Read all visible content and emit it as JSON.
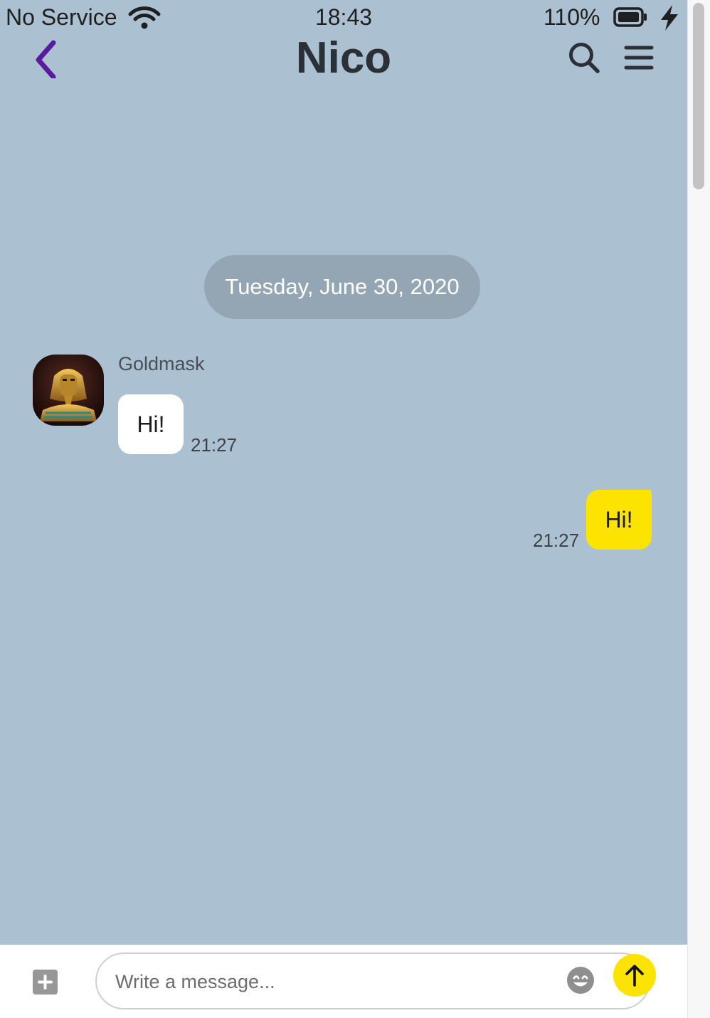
{
  "status_bar": {
    "carrier": "No Service",
    "time": "18:43",
    "battery_percent": "110%",
    "wifi_icon": "wifi-icon",
    "battery_icon": "battery-icon",
    "charging_icon": "lightning-bolt-icon"
  },
  "header": {
    "title": "Nico",
    "back_icon": "chevron-left-icon",
    "search_icon": "search-icon",
    "menu_icon": "hamburger-menu-icon"
  },
  "chat": {
    "date_divider": "Tuesday, June 30, 2020",
    "messages": [
      {
        "direction": "incoming",
        "sender": "Goldmask",
        "text": "Hi!",
        "time": "21:27"
      },
      {
        "direction": "outgoing",
        "text": "Hi!",
        "time": "21:27"
      }
    ]
  },
  "composer": {
    "placeholder": "Write a message...",
    "value": "",
    "add_icon": "plus-square-icon",
    "emoji_icon": "smile-icon",
    "send_icon": "arrow-up-icon"
  },
  "colors": {
    "chat_background": "#abc1d1",
    "accent_back": "#5a1a9e",
    "outgoing_bubble": "#fde400",
    "incoming_bubble": "#ffffff",
    "date_pill": "#94a6b4"
  }
}
